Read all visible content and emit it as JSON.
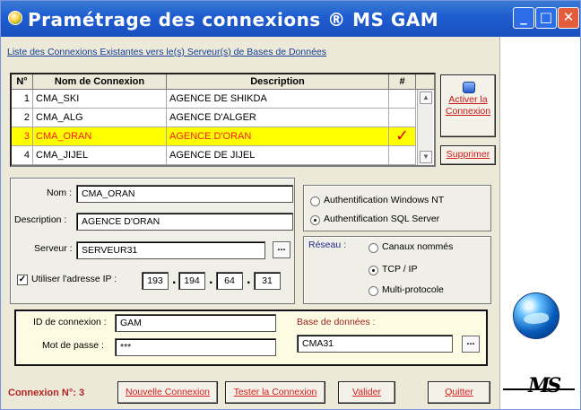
{
  "window": {
    "title": "Pramétrage des connexions ® MS GAM",
    "controls": {
      "minimize": "_",
      "maximize": "□",
      "close": "✕"
    }
  },
  "list": {
    "caption": "Liste des Connexions Existantes vers le(s) Serveur(s) de Bases de Données",
    "columns": [
      "N°",
      "Nom de Connexion",
      "Description",
      "#"
    ],
    "rows": [
      {
        "num": "1",
        "name": "CMA_SKI",
        "description": "AGENCE DE SHIKDA",
        "check": ""
      },
      {
        "num": "2",
        "name": "CMA_ALG",
        "description": "AGENCE D'ALGER",
        "check": ""
      },
      {
        "num": "3",
        "name": "CMA_ORAN",
        "description": "AGENCE D'ORAN",
        "check": "✓"
      },
      {
        "num": "4",
        "name": "CMA_JIJEL",
        "description": "AGENCE DE JIJEL",
        "check": ""
      }
    ]
  },
  "side_buttons": {
    "activate": "Activer la Connexion",
    "delete": "Supprimer"
  },
  "connection": {
    "name_label": "Nom :",
    "name_value": "CMA_ORAN",
    "description_label": "Description :",
    "description_value": "AGENCE D'ORAN",
    "server_label": "Serveur :",
    "server_value": "SERVEUR31",
    "ip_label": "Utiliser l'adresse IP :",
    "ip_values": [
      "193",
      "194",
      "64",
      "31"
    ],
    "ellipsis": "..."
  },
  "authentication": {
    "windows": "Authentification Windows NT",
    "sql": "Authentification SQL Server",
    "selected": "sql"
  },
  "network": {
    "label": "Réseau :",
    "options": [
      "Canaux nommés",
      "TCP / IP",
      "Multi-protocole"
    ],
    "selected": "TCP / IP"
  },
  "login": {
    "id_label": "ID de connexion :",
    "id_value": "GAM",
    "password_label": "Mot de passe :",
    "password_value": "***",
    "database_label": "Base de données :",
    "database_value": "CMA31",
    "ellipsis": "..."
  },
  "footer": {
    "status": "Connexion N°: 3",
    "new": "Nouvelle Connexion",
    "test": "Tester la Connexion",
    "validate": "Valider",
    "quit": "Quitter"
  },
  "logo": {
    "text": "MS"
  }
}
